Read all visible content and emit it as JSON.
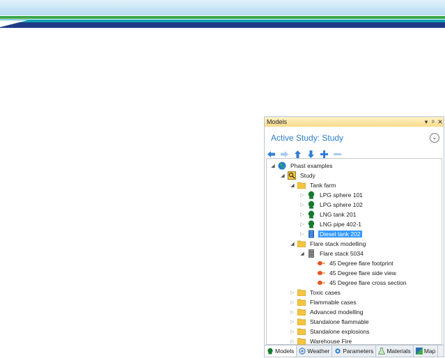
{
  "panel": {
    "title": "Models",
    "controls": {
      "dropdown": "▾",
      "pin": "ᵖ",
      "close": "✕"
    },
    "active_study": "Active Study: Study",
    "expander_glyph": "⌄"
  },
  "toolbar": {
    "buttons": [
      {
        "icon": "arrow-left-icon"
      },
      {
        "icon": "arrow-right-icon"
      },
      {
        "icon": "arrow-up-icon"
      },
      {
        "icon": "arrow-down-icon"
      },
      {
        "icon": "plus-icon"
      },
      {
        "icon": "minus-icon"
      }
    ]
  },
  "tree": {
    "nodes": [
      {
        "label": "Phast examples",
        "icon": "globe-icon",
        "expanded": true
      },
      {
        "label": "Study",
        "icon": "study-icon",
        "expanded": true
      },
      {
        "label": "Tank farm",
        "icon": "folder-icon",
        "expanded": true
      },
      {
        "label": "LPG sphere 101",
        "icon": "vessel-icon",
        "expanded": false
      },
      {
        "label": "LPG sphere 102",
        "icon": "vessel-icon",
        "expanded": false
      },
      {
        "label": "LNG tank 201",
        "icon": "vessel-icon",
        "expanded": false
      },
      {
        "label": "LNG pipe 402-1",
        "icon": "vessel-icon",
        "expanded": false
      },
      {
        "label": "Diesel tank 202",
        "icon": "tank-icon",
        "expanded": false,
        "selected": true
      },
      {
        "label": "Flare stack modelling",
        "icon": "folder-icon",
        "expanded": true
      },
      {
        "label": "Flare stack 5034",
        "icon": "stack-icon",
        "expanded": true
      },
      {
        "label": "45 Degree flare footprint",
        "icon": "flare-icon"
      },
      {
        "label": "45 Degree flare side view",
        "icon": "flare-icon"
      },
      {
        "label": "45 Degree flare cross section",
        "icon": "flare-icon"
      },
      {
        "label": "Toxic cases",
        "icon": "folder-icon",
        "expanded": false
      },
      {
        "label": "Flammable cases",
        "icon": "folder-icon",
        "expanded": false
      },
      {
        "label": "Advanced modelling",
        "icon": "folder-icon",
        "expanded": false
      },
      {
        "label": "Standalone flammable",
        "icon": "folder-icon",
        "expanded": false
      },
      {
        "label": "Standalone explosions",
        "icon": "folder-icon",
        "expanded": false
      },
      {
        "label": "Warehouse Fire",
        "icon": "folder-icon",
        "expanded": false
      }
    ]
  },
  "tabs": [
    {
      "label": "Models",
      "icon": "models-icon",
      "active": true
    },
    {
      "label": "Weather",
      "icon": "weather-icon"
    },
    {
      "label": "Parameters",
      "icon": "parameters-icon"
    },
    {
      "label": "Materials",
      "icon": "materials-icon"
    },
    {
      "label": "Map",
      "icon": "map-icon"
    }
  ],
  "colors": {
    "accent": "#2d7bc4",
    "selection": "#3399ff",
    "titlebar": "#f8dc8c",
    "folder": "#f5c542"
  }
}
